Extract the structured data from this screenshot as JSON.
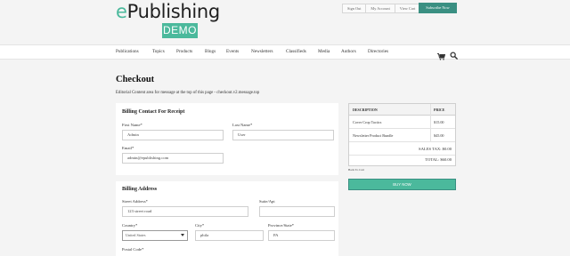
{
  "header": {
    "logo_prefix": "e",
    "logo_main": "Publishing",
    "demo_badge": "DEMO",
    "top_links": [
      "Sign Out",
      "My Account",
      "View Cart"
    ],
    "subscribe_label": "Subscribe Now"
  },
  "nav": {
    "items": [
      "Publications",
      "Topics",
      "Products",
      "Blogs",
      "Events",
      "Newsletters",
      "Classifieds",
      "Media",
      "Authors",
      "Directories"
    ]
  },
  "page": {
    "title": "Checkout",
    "editorial": "Editorial Content area for message at the top of this page - checkout.v2.message.top"
  },
  "contact": {
    "section_title": "Billing Contact For Receipt",
    "first_name_label": "First Name*",
    "first_name_value": "Admin",
    "last_name_label": "Last Name*",
    "last_name_value": "User",
    "email_label": "Email*",
    "email_value": "admin@epublishing.com"
  },
  "address": {
    "section_title": "Billing Address",
    "street_label": "Street Address*",
    "street_value": "123 street road",
    "suite_label": "Suite/Apt",
    "suite_value": "",
    "country_label": "Country*",
    "country_value": "United States",
    "city_label": "City*",
    "city_value": "phila",
    "state_label": "Province/State*",
    "state_value": "PA",
    "postal_label": "Postal Code*"
  },
  "order": {
    "col_description": "DESCRIPTION",
    "col_price": "PRICE",
    "items": [
      {
        "description": "Cover Crop Tactics",
        "price": "$15.00"
      },
      {
        "description": "Newsletter Product Bundle",
        "price": "$45.00"
      }
    ],
    "sales_tax": "SALES TAX: $0.00",
    "total": "TOTAL: $60.00",
    "back_link": "Back To Cart",
    "buy_now": "BUY NOW"
  },
  "colors": {
    "accent": "#4bb99c",
    "accent_dark": "#3a8f82",
    "background": "#f4f4f4"
  }
}
